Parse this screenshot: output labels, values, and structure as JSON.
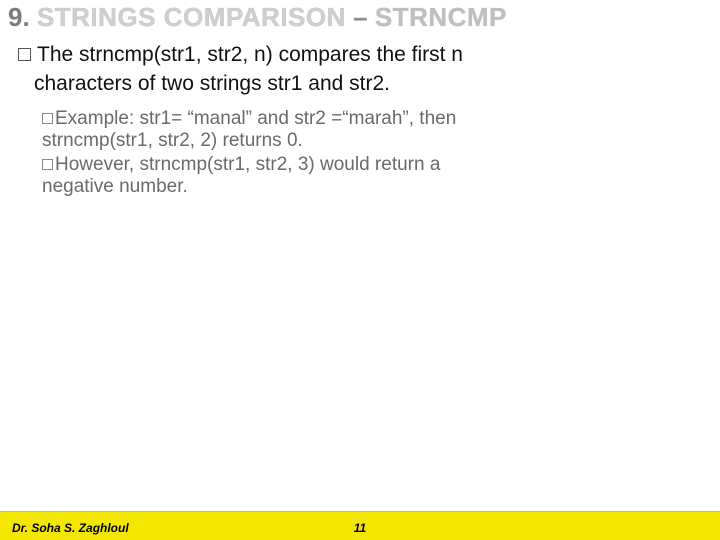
{
  "title": {
    "num": "9.",
    "main": "STRINGS COMPARISON",
    "dash": "–",
    "sub": "STRNCMP"
  },
  "bullet1": {
    "pre": "The ",
    "mono": "strncmp(str1, str2, n)",
    "post": " compares the first n",
    "line2": "characters of two strings ",
    "mono2a": "str1",
    "and": " and ",
    "mono2b": "str2",
    "end": "."
  },
  "sub1": {
    "first": "Example: str1= “manal” and str2 =“marah”, then",
    "cont": "strncmp(str1, str2, 2) returns 0."
  },
  "sub2": {
    "first": "However, strncmp(str1, str2, 3) would return a",
    "cont": "negative number."
  },
  "footer": {
    "author": "Dr. Soha S. Zaghloul",
    "page": "11"
  }
}
